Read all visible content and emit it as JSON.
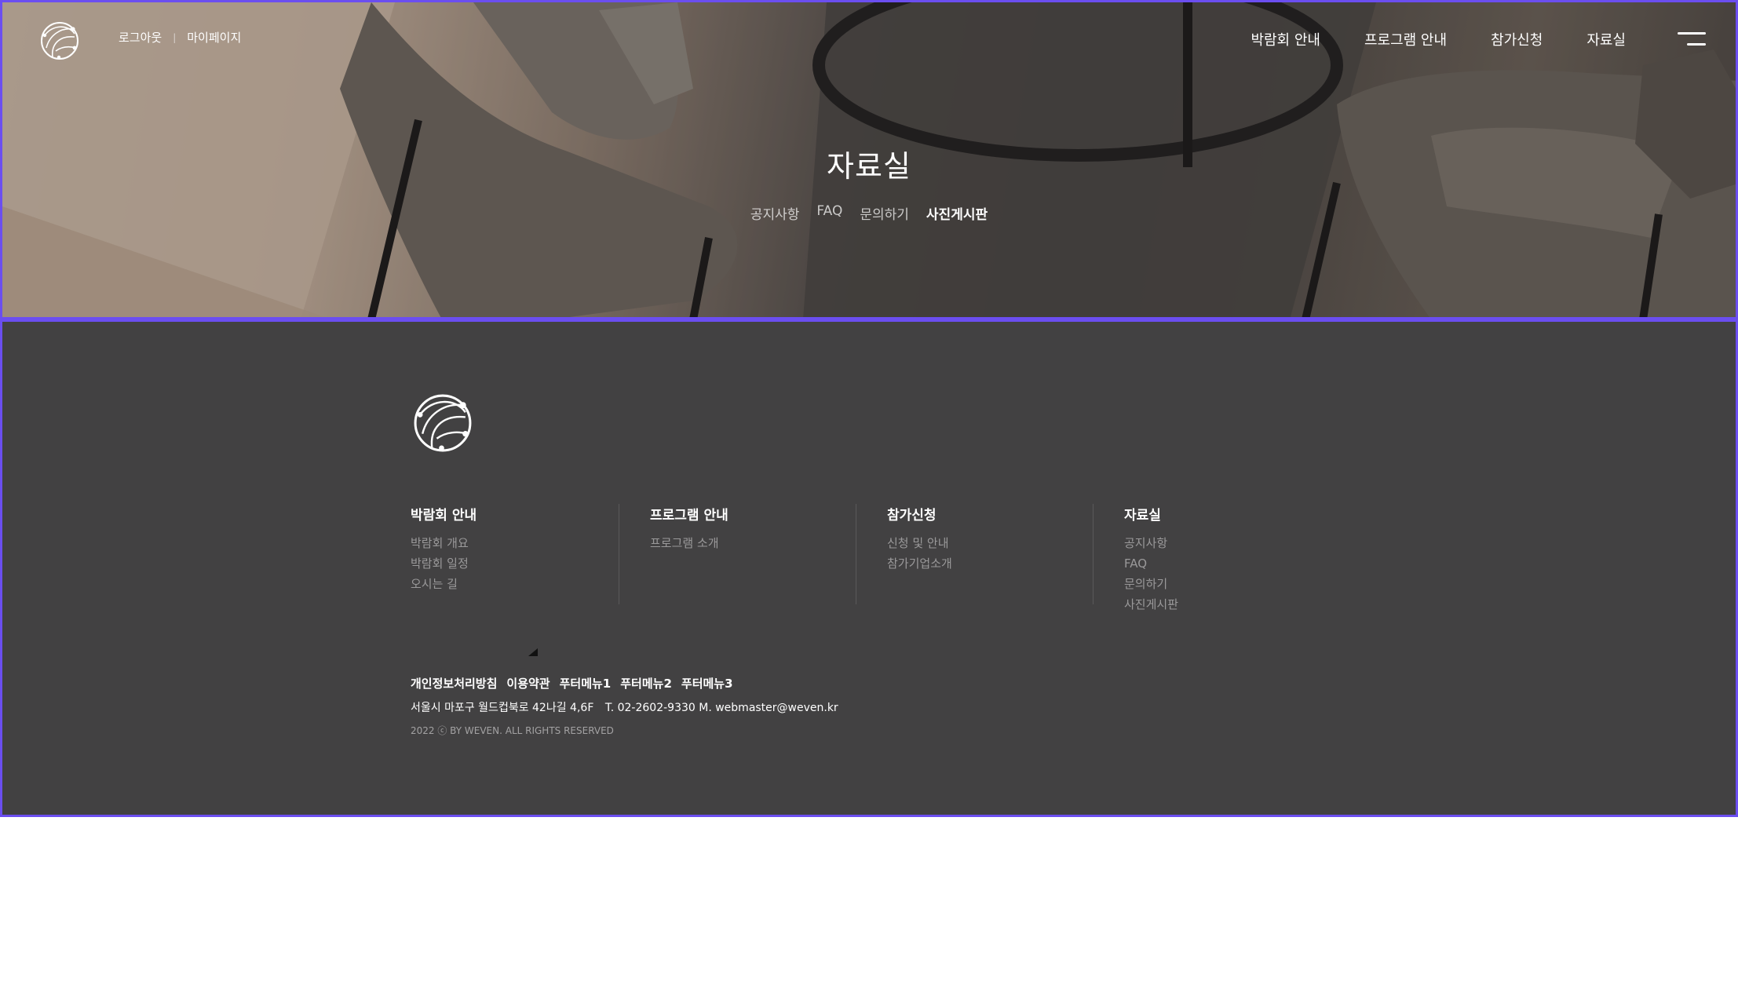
{
  "header": {
    "util_links": [
      "로그아웃",
      "마이페이지"
    ],
    "util_separator": "|",
    "nav": [
      "박람회 안내",
      "프로그램 안내",
      "참가신청",
      "자료실"
    ]
  },
  "hero": {
    "title": "자료실",
    "tabs": [
      "공지사항",
      "FAQ",
      "문의하기",
      "사진게시판"
    ],
    "active_tab": "사진게시판"
  },
  "footer": {
    "sitemap": [
      {
        "title": "박람회 안내",
        "links": [
          "박람회 개요",
          "박람회 일정",
          "오시는 길"
        ]
      },
      {
        "title": "프로그램 안내",
        "links": [
          "프로그램 소개"
        ]
      },
      {
        "title": "참가신청",
        "links": [
          "신청 및 안내",
          "참가기업소개"
        ]
      },
      {
        "title": "자료실",
        "links": [
          "공지사항",
          "FAQ",
          "문의하기",
          "사진게시판"
        ]
      }
    ],
    "policy_links": [
      "개인정보처리방침",
      "이용약관",
      "푸터메뉴1",
      "푸터메뉴2",
      "푸터메뉴3"
    ],
    "address": "서울시 마포구 월드컵북로 42나길 4,6F",
    "contact": "T. 02-2602-9330 M. webmaster@weven.kr",
    "copyright": "2022 ⓒ BY WEVEN. ALL RIGHTS RESERVED"
  },
  "colors": {
    "accent_border": "#6b4ef0",
    "footer_bg": "#424142",
    "text_white": "#ffffff",
    "text_muted": "#9a999a"
  },
  "icons": [
    "logo-globe-icon",
    "menu-hamburger-icon"
  ]
}
